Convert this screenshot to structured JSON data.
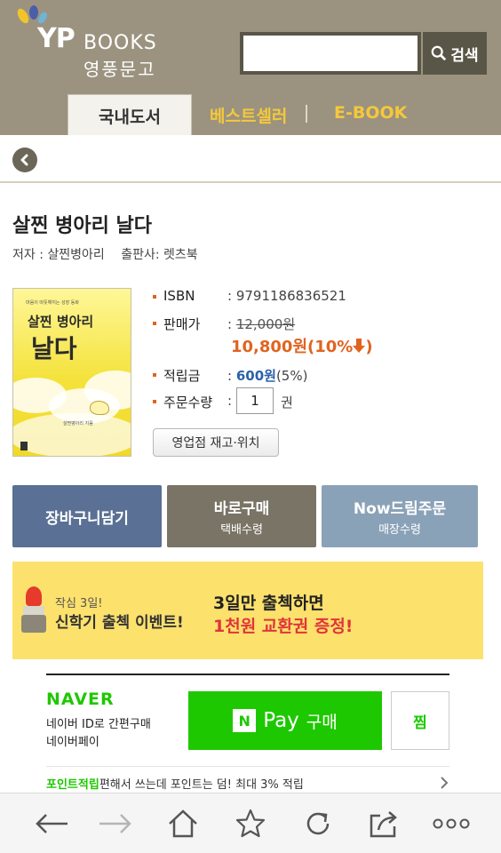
{
  "header": {
    "logo_yp": "YP",
    "logo_books": "BOOKS",
    "logo_kr": "영풍문고",
    "search_placeholder": "",
    "search_button": "검색"
  },
  "tabs": [
    {
      "label": "국내도서",
      "active": true
    },
    {
      "label": "베스트셀러",
      "active": false
    },
    {
      "label": "E-BOOK",
      "active": false
    }
  ],
  "book": {
    "title": "살찐 병아리 날다",
    "author_label": "저자 : 살찐병아리",
    "publisher_label": "출판사: 렛츠북",
    "cover_small_text": "마음이 따뜻해지는 성장 동화",
    "cover_title_line1": "살찐 병아리",
    "cover_title_line2": "날다",
    "cover_author_text": "살찐병아리 지음",
    "isbn_label": "ISBN",
    "isbn": ": 9791186836521",
    "price_label": "판매가",
    "price_original": "12,000원",
    "price_prefix": ": ",
    "price_sale": "10,800원(10%",
    "points_label": "적립금",
    "points_prefix": ": ",
    "points_value": "600원",
    "points_rate": "(5%)",
    "qty_label": "주문수량",
    "qty_prefix": ":",
    "qty_value": "1",
    "qty_unit": "권",
    "store_button": "영업점 재고·위치"
  },
  "actions": [
    {
      "line1": "장바구니담기",
      "line2": ""
    },
    {
      "line1": "바로구매",
      "line2": "택배수령"
    },
    {
      "line1": "Now드림주문",
      "line2": "매장수령"
    }
  ],
  "banner": {
    "small": "작심 3일!",
    "big": "신학기 출첵 이벤트!",
    "right1": "3일만 출첵하면",
    "right2": "1천원 교환권 증정!"
  },
  "naverpay": {
    "logo": "NAVER",
    "desc1": "네이버 ID로 간편구매",
    "desc2": "네이버페이",
    "n_mark": "N",
    "pay": "Pay",
    "buy": "구매",
    "jjim": "찜",
    "points_green": "포인트적립",
    "points_rest": "편해서 쓰는데 포인트는 덤! 최대 3% 적립"
  },
  "colors": {
    "header_bg": "#9b9380",
    "accent_orange": "#e06420",
    "naver_green": "#1ec800",
    "btn_cart": "#5a7094",
    "btn_buy": "#797465",
    "btn_now": "#8aa2b8",
    "banner_bg": "#fce16d"
  }
}
